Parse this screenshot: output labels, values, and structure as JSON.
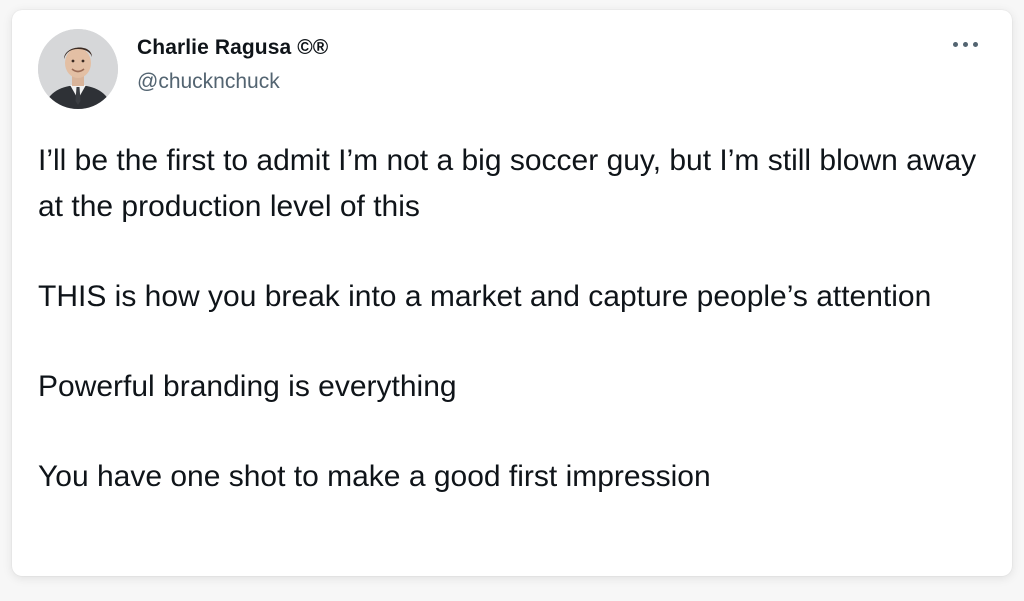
{
  "author": {
    "name": "Charlie Ragusa ©®",
    "handle": "@chucknchuck"
  },
  "tweet": {
    "paragraphs": [
      "I’ll be the first to admit I’m not a big soccer guy, but I’m still blown away at the production level of this",
      "THIS is how you break into a market and capture people’s attention",
      "Powerful branding is everything",
      "You have one shot to make a good first impression"
    ]
  },
  "icons": {
    "more": "more-horizontal-icon"
  },
  "colors": {
    "text": "#0f1419",
    "secondary_text": "#536471"
  }
}
